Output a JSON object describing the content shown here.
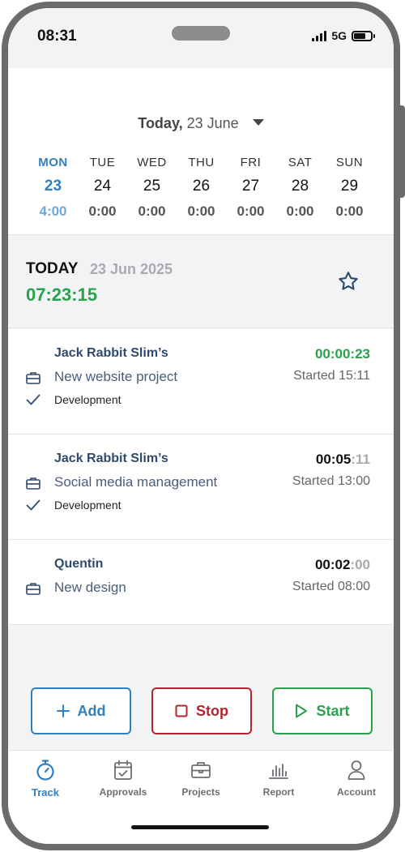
{
  "status_bar": {
    "time": "08:31",
    "network": "5G"
  },
  "date_selector": {
    "prefix": "Today,",
    "date": "23 June"
  },
  "week": [
    {
      "name": "MON",
      "date": "23",
      "hours": "4:00",
      "active": true
    },
    {
      "name": "TUE",
      "date": "24",
      "hours": "0:00"
    },
    {
      "name": "WED",
      "date": "25",
      "hours": "0:00"
    },
    {
      "name": "THU",
      "date": "26",
      "hours": "0:00"
    },
    {
      "name": "FRI",
      "date": "27",
      "hours": "0:00"
    },
    {
      "name": "SAT",
      "date": "28",
      "hours": "0:00"
    },
    {
      "name": "SUN",
      "date": "29",
      "hours": "0:00"
    }
  ],
  "today": {
    "label": "TODAY",
    "date": "23 Jun 2025",
    "total": "07:23:15"
  },
  "entries": [
    {
      "client": "Jack Rabbit Slim’s",
      "timer_main": "00:00:23",
      "timer_sec": "",
      "running": true,
      "project": "New website project",
      "started": "Started 15:11",
      "task": "Development"
    },
    {
      "client": "Jack Rabbit Slim’s",
      "timer_main": "00:05",
      "timer_sec": ":11",
      "running": false,
      "project": "Social media management",
      "started": "Started 13:00",
      "task": "Development"
    },
    {
      "client": "Quentin",
      "timer_main": "00:02",
      "timer_sec": ":00",
      "running": false,
      "project": "New design",
      "started": "Started 08:00",
      "task": ""
    }
  ],
  "actions": {
    "add": "Add",
    "stop": "Stop",
    "start": "Start"
  },
  "tabs": [
    {
      "label": "Track",
      "icon": "stopwatch-icon",
      "active": true
    },
    {
      "label": "Approvals",
      "icon": "calendar-check-icon"
    },
    {
      "label": "Projects",
      "icon": "briefcase-icon"
    },
    {
      "label": "Report",
      "icon": "bar-chart-icon"
    },
    {
      "label": "Account",
      "icon": "user-icon"
    }
  ],
  "colors": {
    "accent": "#2f7fc1",
    "running": "#2aa14c",
    "stop": "#b3262d"
  }
}
